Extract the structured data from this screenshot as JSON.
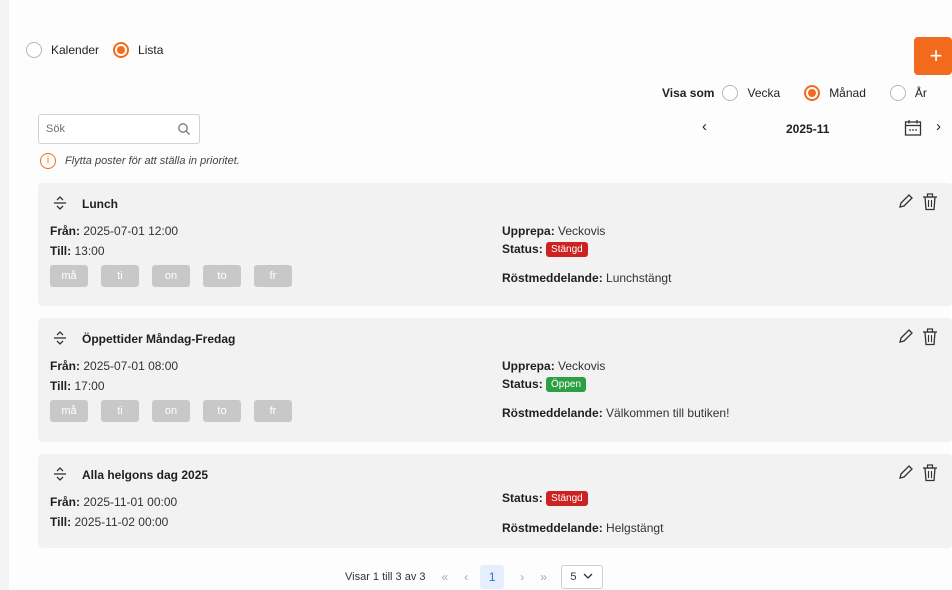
{
  "view_mode": {
    "options": [
      {
        "label": "Kalender",
        "selected": false
      },
      {
        "label": "Lista",
        "selected": true
      }
    ]
  },
  "add_button": {
    "icon": "plus-icon",
    "label": "+"
  },
  "visa_som": {
    "label": "Visa som",
    "options": [
      {
        "label": "Vecka",
        "selected": false
      },
      {
        "label": "Månad",
        "selected": true
      },
      {
        "label": "År",
        "selected": false
      }
    ]
  },
  "search": {
    "placeholder": "Sök",
    "value": ""
  },
  "date_nav": {
    "prev": "‹",
    "current": "2025-11",
    "next": "›"
  },
  "info_text": "Flytta poster för att ställa in prioritet.",
  "labels": {
    "from": "Från",
    "to": "Till",
    "repeat": "Upprepa",
    "status": "Status",
    "voice": "Röstmeddelande"
  },
  "entries": [
    {
      "title": "Lunch",
      "from": "2025-07-01 12:00",
      "to": "13:00",
      "days": [
        "må",
        "ti",
        "on",
        "to",
        "fr"
      ],
      "repeat": "Veckovis",
      "status": "Stängd",
      "voice": "Lunchstängt"
    },
    {
      "title": "Öppettider Måndag-Fredag",
      "from": "2025-07-01 08:00",
      "to": "17:00",
      "days": [
        "må",
        "ti",
        "on",
        "to",
        "fr"
      ],
      "repeat": "Veckovis",
      "status": "Öppen",
      "voice": "Välkommen till butiken!"
    },
    {
      "title": "Alla helgons dag 2025",
      "from": "2025-11-01 00:00",
      "to": "2025-11-02 00:00",
      "status": "Stängd",
      "voice": "Helgstängt"
    }
  ],
  "pagination": {
    "summary": "Visar 1 till 3 av 3",
    "first": "«",
    "prev": "‹",
    "current_page": "1",
    "next": "›",
    "last": "»",
    "page_size": "5"
  },
  "colors": {
    "accent": "#f26b1d",
    "closed": "#cc2222",
    "open": "#2ea043"
  }
}
